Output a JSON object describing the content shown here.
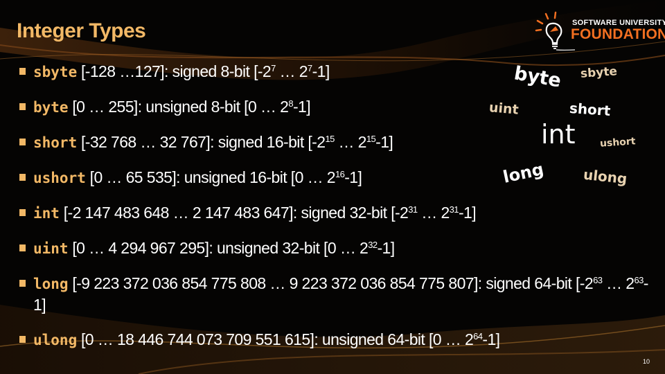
{
  "slide": {
    "title": "Integer Types",
    "page_number": "10",
    "logo": {
      "line1": "SOFTWARE UNIVERSITY",
      "line2": "FOUNDATION",
      "icon": "lightbulb-icon"
    },
    "accent_color": "#f2b866",
    "brand_color": "#f26f21"
  },
  "bullets": [
    {
      "keyword": "sbyte",
      "range": " [-128 …127]: signed 8-bit [-2",
      "sup1": "7",
      "mid": " … 2",
      "sup2": "7",
      "tail": "-1]"
    },
    {
      "keyword": "byte",
      "range": " [0 … 255]: unsigned 8-bit [0 … 2",
      "sup1": "8",
      "mid": "",
      "sup2": "",
      "tail": "-1]"
    },
    {
      "keyword": "short",
      "range": " [-32 768 … 32 767]: signed 16-bit [-2",
      "sup1": "15",
      "mid": " … 2",
      "sup2": "15",
      "tail": "-1]"
    },
    {
      "keyword": "ushort",
      "range": " [0 … 65 535]: unsigned 16-bit [0 … 2",
      "sup1": "16",
      "mid": "",
      "sup2": "",
      "tail": "-1]"
    },
    {
      "keyword": "int",
      "range": " [-2 147 483 648 … 2 147 483 647]: signed 32-bit [-2",
      "sup1": "31",
      "mid": " … 2",
      "sup2": "31",
      "tail": "-1]"
    },
    {
      "keyword": "uint",
      "range": " [0 … 4 294 967 295]: unsigned 32-bit [0 … 2",
      "sup1": "32",
      "mid": "",
      "sup2": "",
      "tail": "-1]"
    },
    {
      "keyword": "long",
      "range": " [-9 223 372 036 854 775 808 … 9 223 372 036 854 775 807]: signed 64-bit [-2",
      "sup1": "63",
      "mid": " … 2",
      "sup2": "63",
      "tail": "-1]"
    },
    {
      "keyword": "ulong",
      "range": " [0 … 18 446 744 073 709 551 615]: unsigned 64-bit [0 … 2",
      "sup1": "64",
      "mid": "",
      "sup2": "",
      "tail": "-1]"
    }
  ],
  "word_cloud": [
    "byte",
    "sbyte",
    "uint",
    "short",
    "int",
    "ushort",
    "long",
    "ulong"
  ]
}
